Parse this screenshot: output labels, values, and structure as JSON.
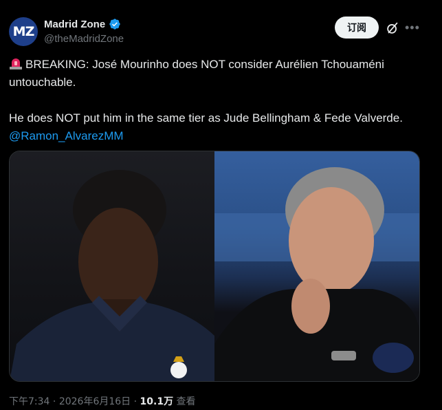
{
  "account": {
    "avatar_text": "MZ",
    "display_name": "Madrid Zone",
    "handle": "@theMadridZone",
    "verified": true
  },
  "actions": {
    "subscribe_label": "订阅",
    "grok_icon": "grok-icon",
    "more_icon": "more-icon"
  },
  "tweet": {
    "line1": "BREAKING: José Mourinho does NOT consider Aurélien Tchouaméni untouchable.",
    "line2": "He does NOT put him in the same tier as Jude Bellingham & Fede Valverde. ",
    "mention": "@Ramon_AlvarezMM",
    "emoji": "rotating-light-icon"
  },
  "media": {
    "left_image": "player-photo",
    "right_image": "manager-photo"
  },
  "meta": {
    "time": "下午7:34",
    "date": "2026年6月16日",
    "separator": "·",
    "views_count": "10.1万",
    "views_label": "查看"
  },
  "colors": {
    "background": "#000000",
    "text": "#e7e9ea",
    "muted": "#71767b",
    "link": "#1d9bf0",
    "verified": "#1d9bf0"
  }
}
